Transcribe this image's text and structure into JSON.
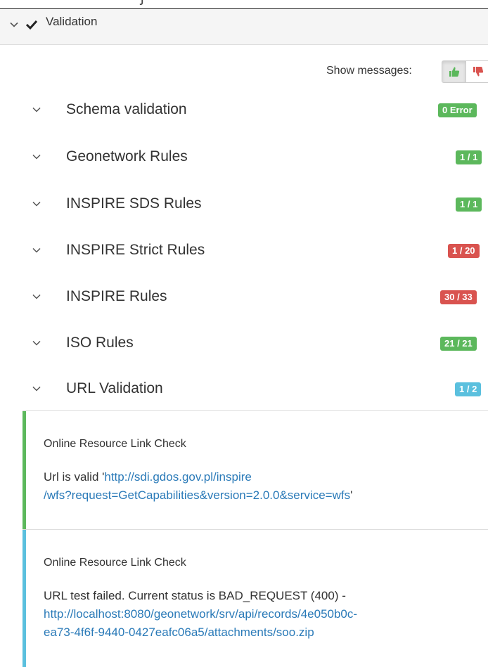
{
  "header": {
    "title": "Validation",
    "clip_text": "ʃ"
  },
  "show_messages": {
    "label": "Show messages:"
  },
  "rules": [
    {
      "name": "Schema validation",
      "badge": "0 Error",
      "status": "ok"
    },
    {
      "name": "Geonetwork Rules",
      "badge": "1 / 1",
      "status": "ok"
    },
    {
      "name": "INSPIRE SDS Rules",
      "badge": "1 / 1",
      "status": "ok"
    },
    {
      "name": "INSPIRE Strict Rules",
      "badge": "1 / 20",
      "status": "fail"
    },
    {
      "name": "INSPIRE Rules",
      "badge": "30 / 33",
      "status": "fail"
    },
    {
      "name": "ISO Rules",
      "badge": "21 / 21",
      "status": "ok"
    },
    {
      "name": "URL Validation",
      "badge": "1 / 2",
      "status": "info"
    }
  ],
  "messages": [
    {
      "title": "Online Resource Link Check",
      "text_prefix": "Url is valid '",
      "link_line1": "http://sdi.gdos.gov.pl/inspire",
      "link_line2": "/wfs?request=GetCapabilities&version=2.0.0&service=wfs",
      "text_suffix": "'",
      "status": "success"
    },
    {
      "title": "Online Resource Link Check",
      "text_prefix": "URL test failed. Current status is BAD_REQUEST (400) -",
      "link_line1": "http://localhost:8080/geonetwork/srv/api/records/4e050b0c-",
      "link_line2": "ea73-4f6f-9440-0427eafc06a5/attachments/soo.zip",
      "status": "info"
    }
  ],
  "colors": {
    "success": "#5cb85c",
    "danger": "#d9534f",
    "info": "#5bc0de",
    "link": "#2a7ab8"
  }
}
